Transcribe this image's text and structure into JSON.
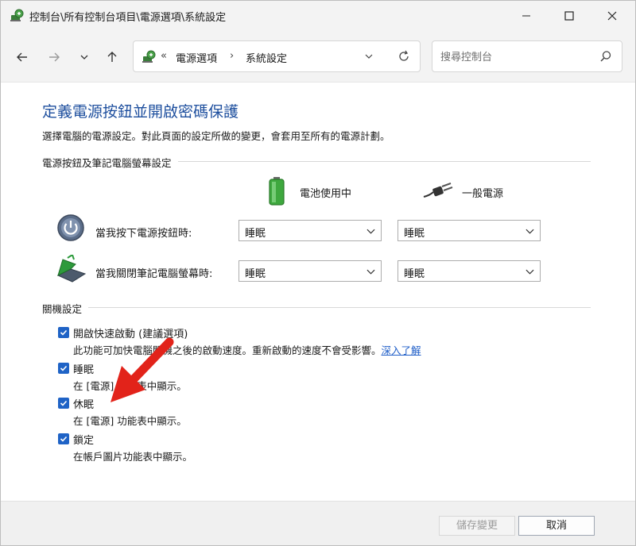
{
  "window": {
    "title": "控制台\\所有控制台項目\\電源選項\\系統設定",
    "controls": [
      "minimize-icon",
      "maximize-icon",
      "close-icon"
    ]
  },
  "address_bar": {
    "prefix": "«",
    "crumbs": [
      "電源選項",
      "系統設定"
    ],
    "separator": "›"
  },
  "search": {
    "placeholder": "搜尋控制台"
  },
  "heading": "定義電源按鈕並開啟密碼保護",
  "description": "選擇電腦的電源設定。對此頁面的設定所做的變更，會套用至所有的電源計劃。",
  "power_group": {
    "label": "電源按鈕及筆記電腦螢幕設定",
    "columns": [
      {
        "label": "電池使用中",
        "icon": "battery-icon"
      },
      {
        "label": "一般電源",
        "icon": "power-plug-icon"
      }
    ],
    "rows": [
      {
        "label": "當我按下電源按鈕時:",
        "icon": "power-button-icon",
        "battery_value": "睡眠",
        "plugged_value": "睡眠"
      },
      {
        "label": "當我關閉筆記電腦螢幕時:",
        "icon": "laptop-lid-icon",
        "battery_value": "睡眠",
        "plugged_value": "睡眠"
      }
    ]
  },
  "shutdown_group": {
    "label": "關機設定",
    "options": [
      {
        "label": "開啟快速啟動 (建議選項)",
        "checked": true,
        "desc": "此功能可加快電腦關機之後的啟動速度。重新啟動的速度不會受影響。",
        "link": "深入了解"
      },
      {
        "label": "睡眠",
        "checked": true,
        "desc": "在 [電源] 功能表中顯示。"
      },
      {
        "label": "休眠",
        "checked": true,
        "desc": "在 [電源] 功能表中顯示。"
      },
      {
        "label": "鎖定",
        "checked": true,
        "desc": "在帳戶圖片功能表中顯示。"
      }
    ]
  },
  "footer": {
    "save_label": "儲存變更",
    "cancel_label": "取消"
  },
  "colors": {
    "heading": "#1e4f9e",
    "checkbox": "#1f63c6",
    "link": "#1f5ec8",
    "annotation_arrow": "#e2231a"
  }
}
